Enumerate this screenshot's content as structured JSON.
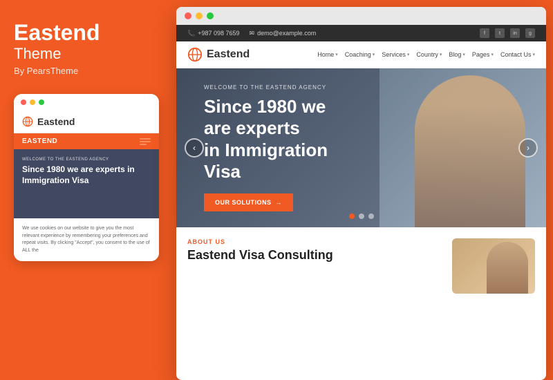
{
  "left": {
    "brand": {
      "name": "Eastend",
      "theme_label": "Theme",
      "by": "By PearsTheme"
    },
    "mobile_preview": {
      "dots": [
        "red",
        "yellow",
        "green"
      ],
      "logo": "Eastend",
      "nav_label": "EASTEND",
      "hero": {
        "welcome": "WELCOME TO THE EASTEND AGENCY",
        "title": "Since 1980 we are experts in Immigration Visa"
      },
      "body_text": "We use cookies on our website to give you the most relevant experience by remembering your preferences and repeat visits. By clicking \"Accept\", you consent to the use of ALL the"
    }
  },
  "browser": {
    "topbar": {
      "phone": "+987 098 7659",
      "email": "demo@example.com",
      "socials": [
        "f",
        "t",
        "in",
        "g"
      ]
    },
    "nav": {
      "logo": "Eastend",
      "items": [
        {
          "label": "Home",
          "has_dropdown": true
        },
        {
          "label": "Coaching",
          "has_dropdown": true
        },
        {
          "label": "Services",
          "has_dropdown": true
        },
        {
          "label": "Country",
          "has_dropdown": true
        },
        {
          "label": "Blog",
          "has_dropdown": true
        },
        {
          "label": "Pages",
          "has_dropdown": true
        },
        {
          "label": "Contact Us",
          "has_dropdown": true
        }
      ]
    },
    "hero": {
      "welcome": "WELCOME TO THE EASTEND AGENCY",
      "title_line1": "Since 1980 we are experts",
      "title_line2": "in Immigration Visa",
      "cta_label": "OUR SOLUTIONS",
      "prev_icon": "‹",
      "next_icon": "›",
      "dots": [
        true,
        false,
        false
      ]
    },
    "below_hero": {
      "about_label": "ABOUT US",
      "about_title": "Eastend Visa Consulting"
    }
  },
  "colors": {
    "brand_orange": "#f15a22",
    "dark": "#2d2d2d",
    "white": "#ffffff"
  },
  "icons": {
    "phone": "📞",
    "email": "✉",
    "globe": "🌐"
  }
}
